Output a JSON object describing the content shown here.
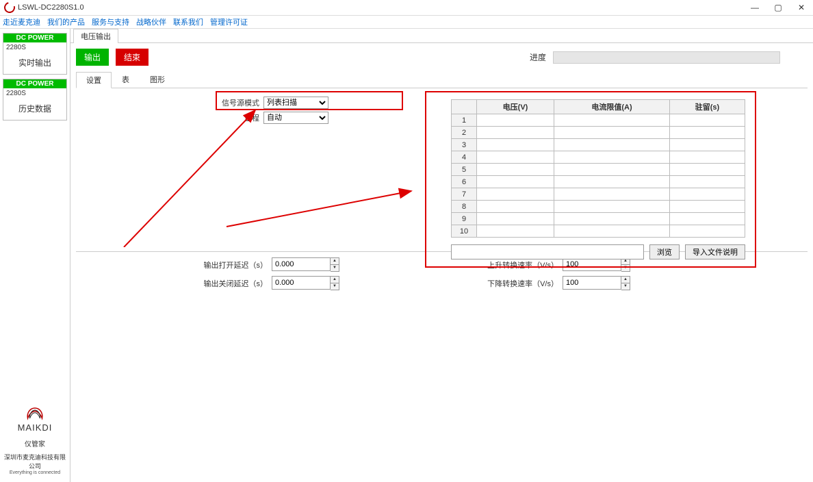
{
  "window": {
    "title": "LSWL-DC2280S1.0"
  },
  "menu": {
    "m1": "走近麦克迪",
    "m2": "我们的产品",
    "m3": "服务与支持",
    "m4": "战略伙伴",
    "m5": "联系我们",
    "m6": "管理许可证"
  },
  "sidebar": {
    "card1": {
      "hdr": "DC POWER",
      "dev": "2280S",
      "main": "实时输出"
    },
    "card2": {
      "hdr": "DC POWER",
      "dev": "2280S",
      "main": "历史数据"
    },
    "footer": {
      "brand": "MAIKDI",
      "sub": "仪管家",
      "company": "深圳市麦克迪科技有限公司",
      "tiny": "Everything is connected"
    }
  },
  "tab": {
    "main": "电压输出"
  },
  "buttons": {
    "output": "输出",
    "end": "结束"
  },
  "progressLabel": "进度",
  "subtabs": {
    "t1": "设置",
    "t2": "表",
    "t3": "图形"
  },
  "config": {
    "sourceModeLabel": "信号源模式",
    "sourceModeValue": "列表扫描",
    "rangeLabel": "量程",
    "rangeValue": "自动"
  },
  "table": {
    "hVoltage": "电压(V)",
    "hCurrent": "电流限值(A)",
    "hDwell": "驻留(s)",
    "rows": [
      "1",
      "2",
      "3",
      "4",
      "5",
      "6",
      "7",
      "8",
      "9",
      "10"
    ]
  },
  "fileRow": {
    "browse": "浏览",
    "importDesc": "导入文件说明"
  },
  "params": {
    "openDelayLabel": "输出打开延迟（s）",
    "openDelayValue": "0.000",
    "closeDelayLabel": "输出关闭延迟（s）",
    "closeDelayValue": "0.000",
    "riseRateLabel": "上升转换速率（V/s）",
    "riseRateValue": "100",
    "fallRateLabel": "下降转换速率（V/s）",
    "fallRateValue": "100"
  }
}
